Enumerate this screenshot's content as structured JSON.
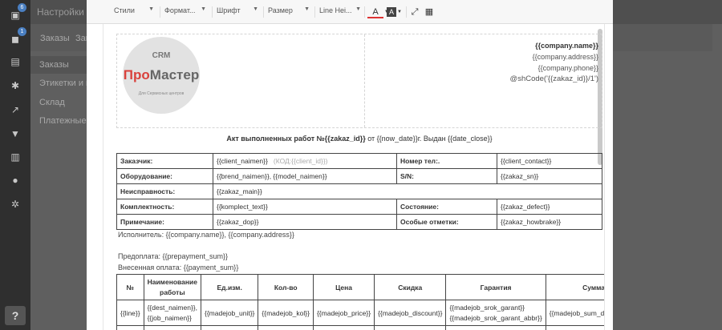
{
  "app": {
    "title": "Настройки",
    "badges": [
      "6",
      "1"
    ],
    "tabs": [
      "Заказы",
      "Зак"
    ],
    "sidebar": [
      "Заказы",
      "Этикетки и це",
      "Склад",
      "Платежные до"
    ],
    "help": "?"
  },
  "toolbar": {
    "styles": "Стили",
    "format": "Формат...",
    "font": "Шрифт",
    "size": "Размер",
    "line_height": "Line Hei...",
    "text_color": "A",
    "bg_color": "A"
  },
  "header": {
    "logo_crm": "CRM",
    "logo_pro": "Про",
    "logo_master": "Мастер",
    "logo_sub": "Для Сервисных центров",
    "company_name": "{{company.name}}",
    "company_address": "{{company.address}}",
    "company_phone": "{{company.phone}}",
    "shcode": "@shCode('{{zakaz_id}}/1')"
  },
  "act": {
    "title": "Акт выполненных работ №{{zakaz_id}}",
    "rest": " от {{now_date}}г. Выдан {{date_close}}"
  },
  "info_table": [
    [
      "Заказчик:",
      "{{client_naimen}}",
      "(КОД:{{client_id}})",
      "Номер тел:.",
      "{{client_contact}}"
    ],
    [
      "Оборудование:",
      "{{brend_naimen}}, {{model_naimen}}",
      "",
      "S/N:",
      "{{zakaz_sn}}"
    ],
    [
      "Неисправность:",
      "{{zakaz_main}}",
      "",
      "",
      ""
    ],
    [
      "Комплектность:",
      "{{komplect_text}}",
      "",
      "Состояние:",
      "{{zakaz_defect}}"
    ],
    [
      "Примечание:",
      "{{zakaz_dop}}",
      "",
      "Особые отметки:",
      "{{zakaz_howbrake}}"
    ]
  ],
  "executor": "Исполнитель: {{company.name}}, {{company.address}}",
  "prepayment": "Предоплата: {{prepayment_sum}}",
  "payment": "Внесенная оплата: {{payment_sum}}",
  "items_header": [
    "№",
    "Наименование работы",
    "Ед.изм.",
    "Кол-во",
    "Цена",
    "Скидка",
    "Гарантия",
    "Сумма"
  ],
  "items_row": [
    "{{line}}",
    "{{dest_naimen}}, {{job_naimen}}",
    "{{madejob_unit}}",
    "{{madejob_kol}}",
    "{{madejob_price}}",
    "{{madejob_discount}}",
    "{{madejob_srok_garant}} {{madejob_srok_garant_abbr}}",
    "{{madejob_sum_discounted}}"
  ]
}
